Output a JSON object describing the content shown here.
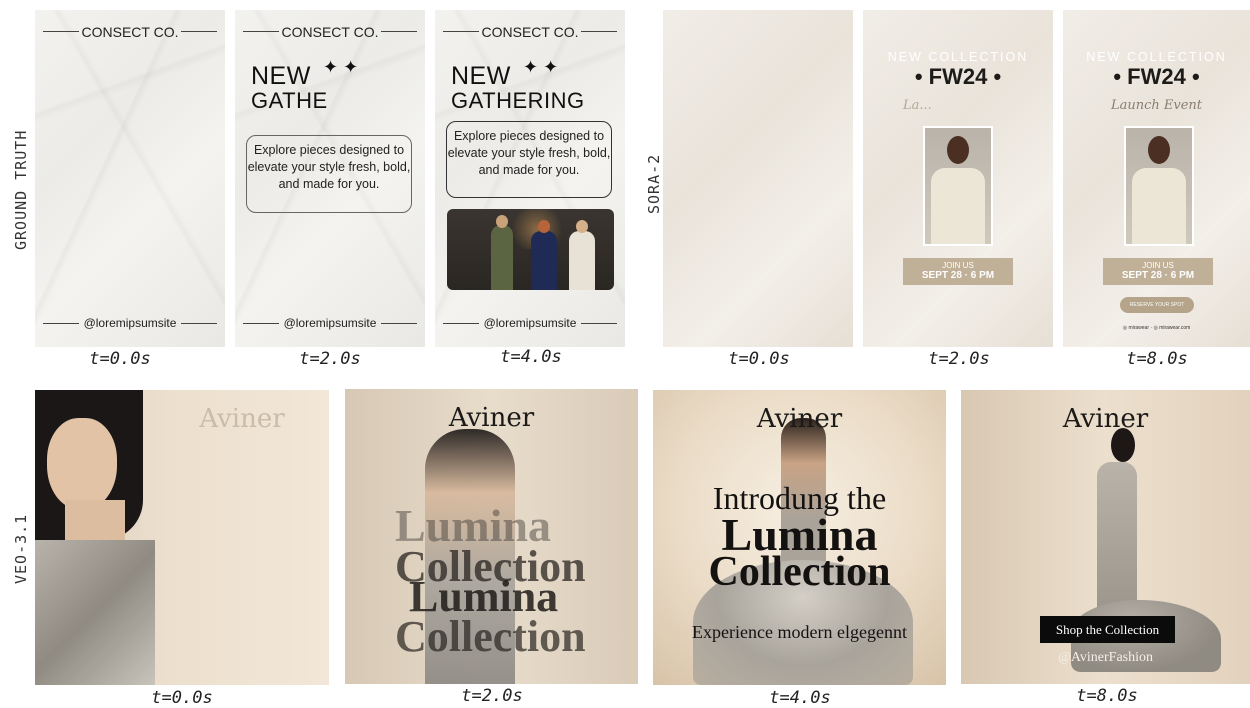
{
  "row_labels": {
    "ground_truth": "GROUND TRUTH",
    "sora": "SORA-2",
    "veo": "VEO-3.1"
  },
  "ground_truth": {
    "brand": "CONSECT CO.",
    "handle": "@loremipsumsite",
    "heading_line1": "NEW",
    "heading_partial_line2": "GATHE",
    "heading_line2": "GATHERING",
    "stars": "✦ ✦",
    "body": "Explore pieces designed to elevate your style fresh, bold, and made for you.",
    "times": [
      "t=0.0s",
      "t=2.0s",
      "t=4.0s"
    ]
  },
  "sora": {
    "new_collection": "NEW COLLECTION",
    "fw": "• FW24 •",
    "launch_partial": "La...",
    "launch_event": "Launch Event",
    "join_us": "JOIN US",
    "date": "SEPT 28 · 6 PM",
    "reserve": "RESERVE YOUR SPOT",
    "socials": "◎ mirawear  ·  ◎ mirawear.com",
    "times": [
      "t=0.0s",
      "t=2.0s",
      "t=8.0s"
    ]
  },
  "veo": {
    "logo": "Aviner",
    "frame2_l1": "Lumina",
    "frame2_l2": "Collection",
    "frame2_l3": "Lumina",
    "frame2_l4": "Collection",
    "frame3_l1": "Introdung the",
    "frame3_l2": "Lumina",
    "frame3_l3": "Collection",
    "frame3_sub": "Experience modern elgegennt",
    "frame4_button": "Shop the Collection",
    "frame4_handle": "@AvinerFashion",
    "times": [
      "t=0.0s",
      "t=2.0s",
      "t=4.0s",
      "t=8.0s"
    ]
  }
}
